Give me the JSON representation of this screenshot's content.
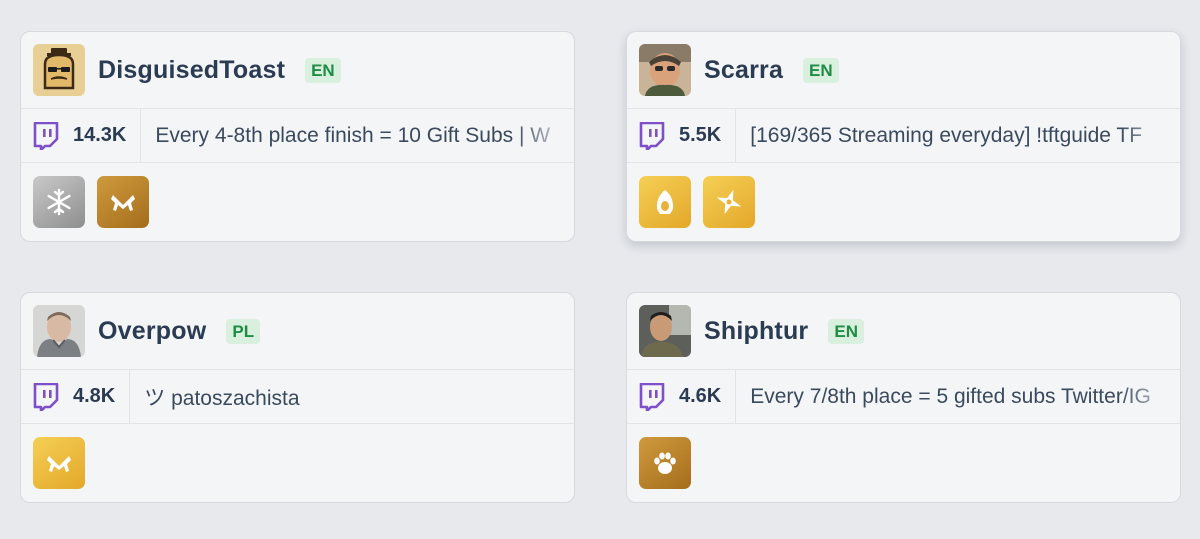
{
  "colors": {
    "background": "#e7e9ed",
    "card": "#f4f5f7",
    "name_text": "#2a3b52",
    "lang_bg": "#d9f0df",
    "lang_text": "#1f8c45",
    "twitch_purple": "#7d4fc9",
    "badge_silver": "#a9a9a9",
    "badge_bronze": "#b97f2b",
    "badge_gold": "#ecbd3e"
  },
  "streamers": [
    {
      "name": "DisguisedToast",
      "language": "EN",
      "platform_icon": "twitch-icon",
      "viewers": "14.3K",
      "title": "Every 4-8th place finish = 10 Gift Subs | W",
      "avatar_icon": "toast-avatar",
      "badges": [
        {
          "icon": "snowflake-icon",
          "tier": "silver"
        },
        {
          "icon": "crossed-pistols-icon",
          "tier": "bronze"
        }
      ]
    },
    {
      "name": "Scarra",
      "language": "EN",
      "platform_icon": "twitch-icon",
      "viewers": "5.5K",
      "title": "[169/365 Streaming everyday] !tftguide TF",
      "avatar_icon": "person-avatar",
      "badges": [
        {
          "icon": "hooded-figure-icon",
          "tier": "gold"
        },
        {
          "icon": "shuriken-icon",
          "tier": "gold"
        }
      ]
    },
    {
      "name": "Overpow",
      "language": "PL",
      "platform_icon": "twitch-icon",
      "viewers": "4.8K",
      "title": "ツ patoszachista",
      "avatar_icon": "person-avatar",
      "badges": [
        {
          "icon": "crossed-pistols-icon",
          "tier": "gold"
        }
      ]
    },
    {
      "name": "Shiphtur",
      "language": "EN",
      "platform_icon": "twitch-icon",
      "viewers": "4.6K",
      "title": "Every 7/8th place = 5 gifted subs Twitter/IG",
      "avatar_icon": "person-avatar",
      "badges": [
        {
          "icon": "paw-icon",
          "tier": "bronze"
        }
      ]
    }
  ]
}
